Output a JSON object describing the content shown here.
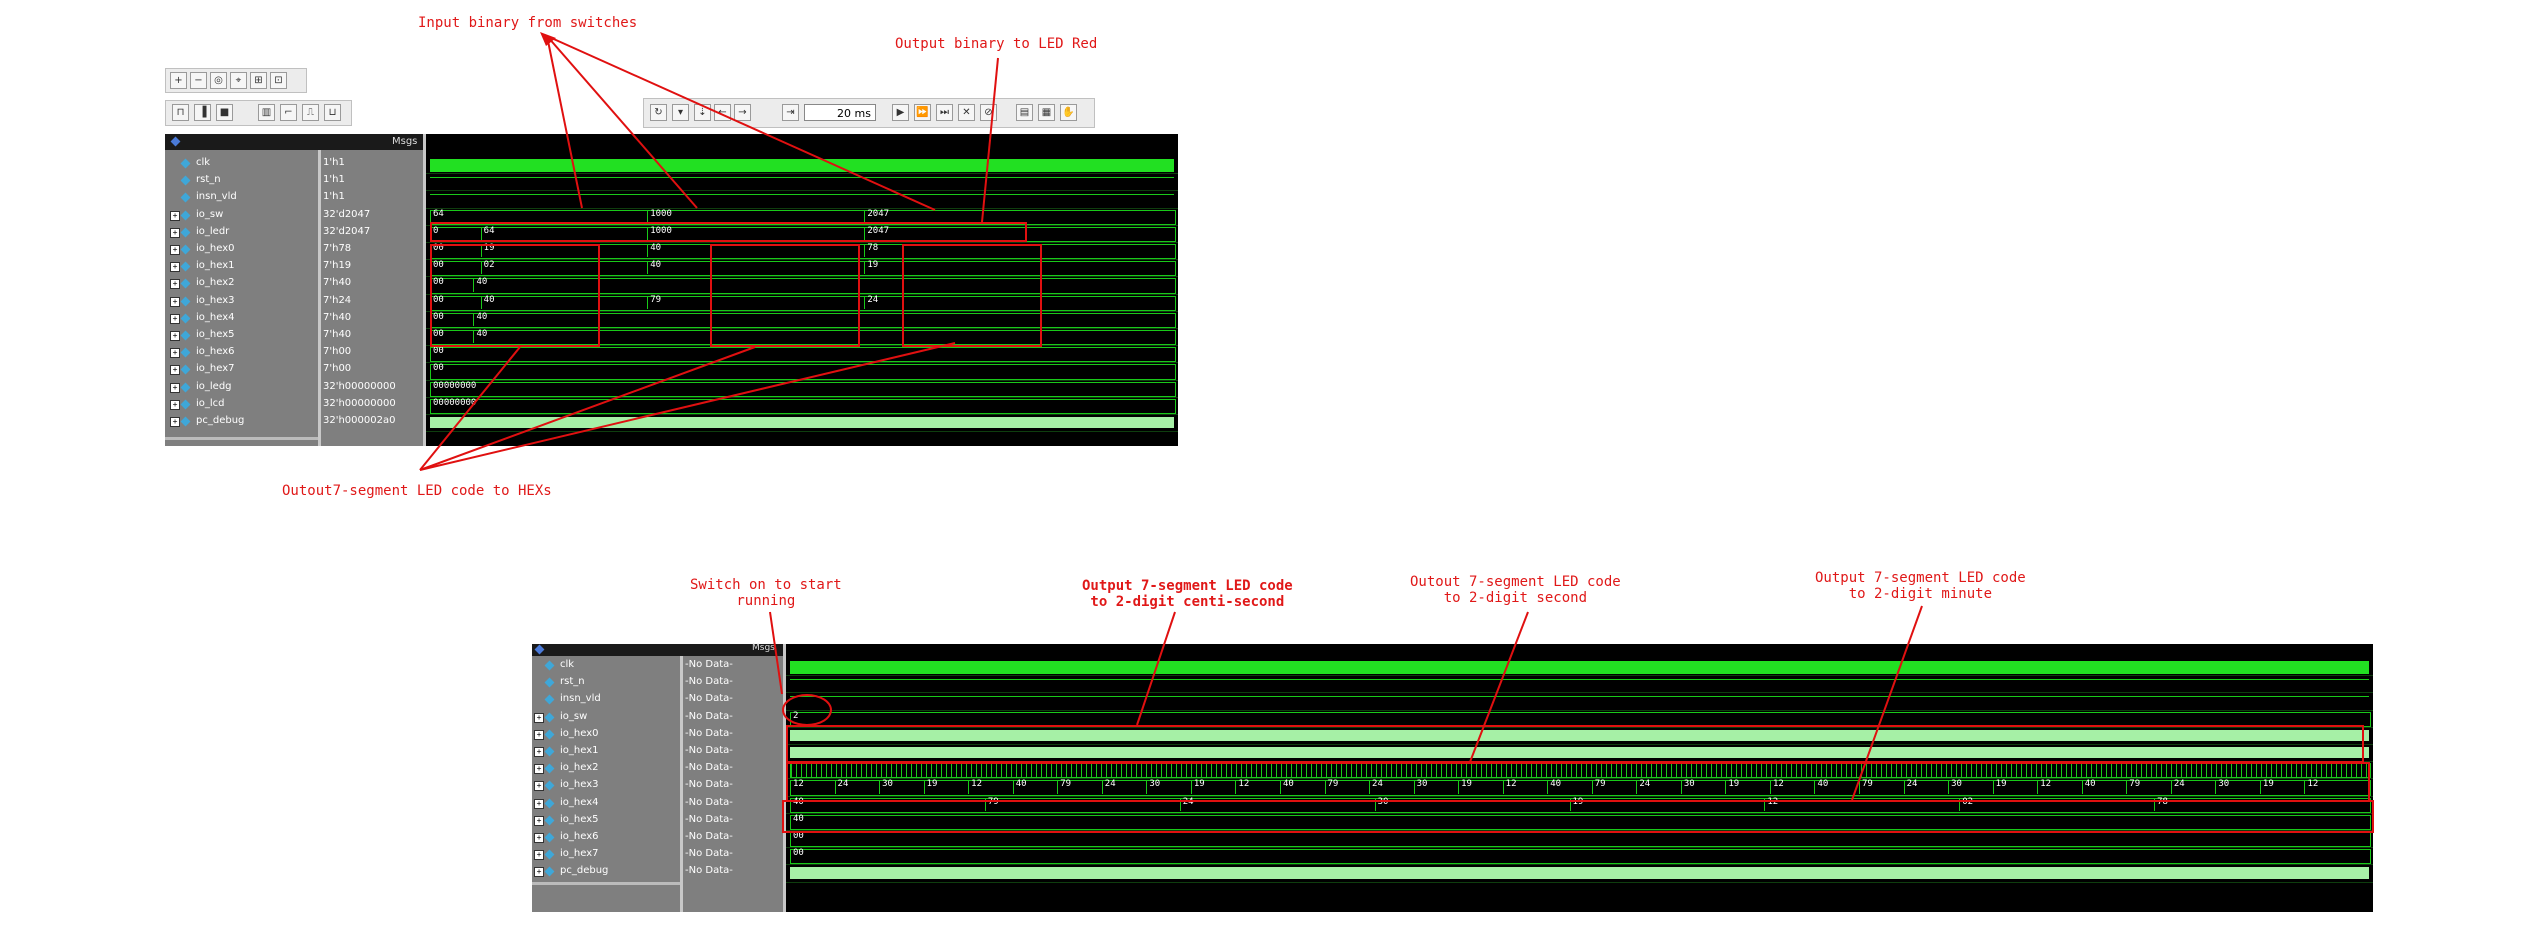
{
  "top": {
    "header_msgs": "Msgs",
    "time_value": "20 ms",
    "signals": [
      {
        "name": "clk",
        "value": "1'h1",
        "kind": "clk",
        "expand": false
      },
      {
        "name": "rst_n",
        "value": "1'h1",
        "kind": "rst",
        "expand": false
      },
      {
        "name": "insn_vld",
        "value": "1'h1",
        "kind": "line",
        "expand": false
      },
      {
        "name": "io_sw",
        "value": "32'd2047",
        "kind": "bus",
        "expand": true
      },
      {
        "name": "io_ledr",
        "value": "32'd2047",
        "kind": "bus",
        "expand": true
      },
      {
        "name": "io_hex0",
        "value": "7'h78",
        "kind": "bus",
        "expand": true
      },
      {
        "name": "io_hex1",
        "value": "7'h19",
        "kind": "bus",
        "expand": true
      },
      {
        "name": "io_hex2",
        "value": "7'h40",
        "kind": "bus",
        "expand": true
      },
      {
        "name": "io_hex3",
        "value": "7'h24",
        "kind": "bus",
        "expand": true
      },
      {
        "name": "io_hex4",
        "value": "7'h40",
        "kind": "bus",
        "expand": true
      },
      {
        "name": "io_hex5",
        "value": "7'h40",
        "kind": "bus",
        "expand": true
      },
      {
        "name": "io_hex6",
        "value": "7'h00",
        "kind": "bus",
        "expand": true
      },
      {
        "name": "io_hex7",
        "value": "7'h00",
        "kind": "bus",
        "expand": true
      },
      {
        "name": "io_ledg",
        "value": "32'h00000000",
        "kind": "bus",
        "expand": true
      },
      {
        "name": "io_lcd",
        "value": "32'h00000000",
        "kind": "bus",
        "expand": true
      },
      {
        "name": "pc_debug",
        "value": "32'h000002a0",
        "kind": "fill",
        "expand": true
      }
    ],
    "bus_labels": {
      "io_sw": [
        "64",
        "1000",
        "2047"
      ],
      "io_ledr": [
        "0",
        "64",
        "1000",
        "2047"
      ],
      "io_hex0": [
        "00",
        "19",
        "40",
        "78"
      ],
      "io_hex1": [
        "00",
        "02",
        "40",
        "19"
      ],
      "io_hex2": [
        "00",
        "40"
      ],
      "io_hex3": [
        "00",
        "40",
        "79",
        "24"
      ],
      "io_hex4": [
        "00",
        "40"
      ],
      "io_hex5": [
        "00",
        "40"
      ],
      "io_hex6": [
        "00"
      ],
      "io_hex7": [
        "00"
      ],
      "io_ledg": [
        "00000000"
      ],
      "io_lcd": [
        "00000000"
      ]
    }
  },
  "bottom": {
    "header_msgs": "Msgs",
    "signals": [
      {
        "name": "clk",
        "value": "-No Data-",
        "kind": "clk",
        "expand": false
      },
      {
        "name": "rst_n",
        "value": "-No Data-",
        "kind": "line",
        "expand": false
      },
      {
        "name": "insn_vld",
        "value": "-No Data-",
        "kind": "line",
        "expand": false
      },
      {
        "name": "io_sw",
        "value": "-No Data-",
        "kind": "bus",
        "expand": true
      },
      {
        "name": "io_hex0",
        "value": "-No Data-",
        "kind": "fill",
        "expand": true
      },
      {
        "name": "io_hex1",
        "value": "-No Data-",
        "kind": "fill",
        "expand": true
      },
      {
        "name": "io_hex2",
        "value": "-No Data-",
        "kind": "dense",
        "expand": true
      },
      {
        "name": "io_hex3",
        "value": "-No Data-",
        "kind": "bus",
        "expand": true
      },
      {
        "name": "io_hex4",
        "value": "-No Data-",
        "kind": "bus",
        "expand": true
      },
      {
        "name": "io_hex5",
        "value": "-No Data-",
        "kind": "bus",
        "expand": true
      },
      {
        "name": "io_hex6",
        "value": "-No Data-",
        "kind": "bus",
        "expand": true
      },
      {
        "name": "io_hex7",
        "value": "-No Data-",
        "kind": "bus",
        "expand": true
      },
      {
        "name": "pc_debug",
        "value": "-No Data-",
        "kind": "fill",
        "expand": true
      }
    ],
    "bus_labels": {
      "io_sw": [
        "2"
      ],
      "io_hex3": [
        "12",
        "24",
        "30",
        "19",
        "12",
        "40",
        "79",
        "24",
        "30",
        "19",
        "12",
        "40",
        "79",
        "24",
        "30",
        "19",
        "12",
        "40",
        "79",
        "24",
        "30",
        "19",
        "12",
        "40",
        "79",
        "24",
        "30",
        "19",
        "12",
        "40",
        "79",
        "24",
        "30",
        "19",
        "12"
      ],
      "io_hex4": [
        "40",
        "79",
        "24",
        "30",
        "19",
        "12",
        "02",
        "78"
      ],
      "io_hex5": [
        "40"
      ],
      "io_hex6": [
        "00"
      ],
      "io_hex7": [
        "00"
      ]
    }
  },
  "annotations": {
    "input_binary": "Input binary from switches",
    "output_binary": "Output binary to LED Red",
    "output_7seg_hex": "Outout7-segment LED code to HEXs",
    "switch_on_line1": "Switch on to start",
    "switch_on_line2": "running",
    "centi_line1": "Output 7-segment LED code",
    "centi_line2": "to 2-digit centi-second",
    "second_line1": "Outout 7-segment LED code",
    "second_line2": "to 2-digit second",
    "minute_line1": "Output 7-segment LED code",
    "minute_line2": "to 2-digit minute"
  },
  "colors": {
    "wave": "#19c919",
    "clock_fill": "#22e022",
    "annotation": "#e01818",
    "name_panel": "#7f7f7f"
  }
}
